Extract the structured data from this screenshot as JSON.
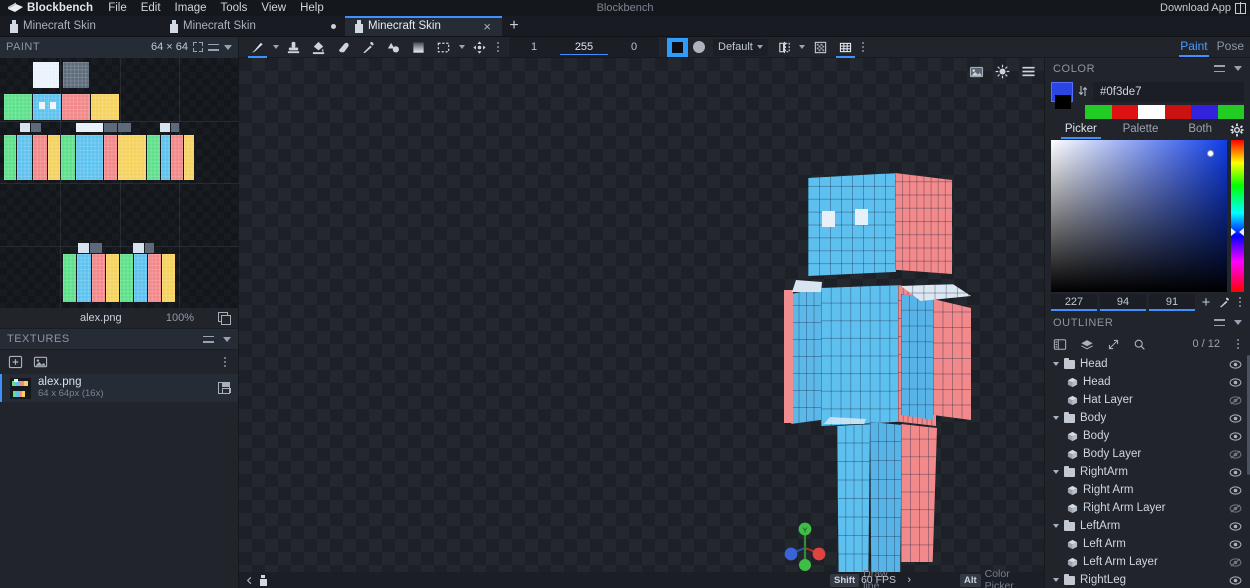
{
  "app": {
    "name": "Blockbench",
    "logo_icon": "blockbench-logo-icon",
    "window_title": "Blockbench",
    "download_app_label": "Download App",
    "restore_icon": "window-restore-icon"
  },
  "menubar": {
    "items": [
      "File",
      "Edit",
      "Image",
      "Tools",
      "View",
      "Help"
    ]
  },
  "tabs": {
    "items": [
      {
        "label": "Minecraft Skin",
        "active": false,
        "modified": false,
        "icon": "skin-person-icon"
      },
      {
        "label": "Minecraft Skin",
        "active": false,
        "modified": true,
        "icon": "skin-person-icon"
      },
      {
        "label": "Minecraft Skin",
        "active": true,
        "modified": false,
        "icon": "skin-person-icon"
      }
    ],
    "add_tab_label": "+",
    "close_label": "×"
  },
  "toolbar": {
    "panel_title": "PAINT",
    "texture_size": "64 × 64",
    "fullscreen_icon": "fullscreen-icon",
    "equals_icon": "drag-handle-icon",
    "chevron_icon": "chevron-down-icon",
    "tools": [
      {
        "name": "brush-tool",
        "label": "Brush",
        "active": true,
        "has_caret": true
      },
      {
        "name": "copy-paste-tool",
        "label": "Copy Paste Tool",
        "active": false
      },
      {
        "name": "fill-tool",
        "label": "Paint Bucket",
        "active": false
      },
      {
        "name": "eraser-tool",
        "label": "Eraser",
        "active": false
      },
      {
        "name": "color-picker-tool",
        "label": "Color Picker",
        "active": false
      },
      {
        "name": "draw-shape-tool",
        "label": "Draw Shape",
        "active": false
      },
      {
        "name": "gradient-tool",
        "label": "Gradient",
        "active": false
      },
      {
        "name": "selection-tool",
        "label": "Selection Tool",
        "active": false,
        "has_caret": true
      },
      {
        "name": "move-layer-tool",
        "label": "Move Layer",
        "active": false
      }
    ],
    "overflow_icon": "vertical-dots-icon",
    "numbers": [
      {
        "name": "brush-size-field",
        "value": "1",
        "active": false
      },
      {
        "name": "brush-opacity-field",
        "value": "255",
        "active": true
      },
      {
        "name": "brush-softness-field",
        "value": "0",
        "active": false
      }
    ],
    "shape_square_label": "square-brush-shape",
    "shape_circle_label": "circle-brush-shape",
    "blend_mode": "Default",
    "mirror_icon": "mirror-painting-icon",
    "pixel_grid_icon": "pixel-grid-icon",
    "grid_icon": "paint-grid-icon",
    "mode_tabs": [
      {
        "label": "Paint",
        "active": true
      },
      {
        "label": "Pose",
        "active": false
      }
    ]
  },
  "texture_panel": {
    "file_name": "alex.png",
    "zoom": "100%",
    "copy_icon": "duplicate-icon",
    "section_title": "TEXTURES",
    "tool_icons": [
      "create-texture-icon",
      "import-texture-icon"
    ],
    "overflow_icon": "vertical-dots-icon",
    "items": [
      {
        "name": "alex.png",
        "resolution": "64 x 64px (16x)",
        "selected": true,
        "save_icon": "save-icon"
      }
    ]
  },
  "viewport": {
    "icons": [
      "screenshot-icon",
      "lighting-icon",
      "viewport-menu-icon"
    ],
    "fps": "60 FPS",
    "fps_arrow": "›",
    "axis_gizmo": {
      "y_label": "Y",
      "x_color": "#e0453f",
      "y_color": "#46c74b",
      "z_color": "#3f6fe0"
    }
  },
  "statusbar": {
    "shortcuts": [
      {
        "key": "Shift",
        "action": "Draw line"
      },
      {
        "key": "Alt",
        "action": "Color Picker"
      }
    ],
    "left_icons": [
      "back-arrow-icon",
      "skin-person-icon"
    ]
  },
  "color_panel": {
    "title": "COLOR",
    "minimize_icon": "drag-handle-icon",
    "collapse_icon": "chevron-down-icon",
    "hex": "#0f3de7",
    "swap_icon": "swap-colors-icon",
    "main_color": "#0f3de7",
    "secondary_color": "#000000",
    "palette": [
      "#22cc22",
      "#dd1111",
      "#ffffff",
      "#cc1111",
      "#3322dd",
      "#22cc22"
    ],
    "tabs": [
      {
        "label": "Picker",
        "active": true
      },
      {
        "label": "Palette",
        "active": false
      },
      {
        "label": "Both",
        "active": false
      }
    ],
    "settings_icon": "gear-icon",
    "hsv": [
      {
        "name": "hue-field",
        "value": "227"
      },
      {
        "name": "saturation-field",
        "value": "94"
      },
      {
        "name": "value-field",
        "value": "91"
      }
    ],
    "add_color_label": "+",
    "eyedropper_icon": "eyedropper-icon",
    "overflow_icon": "vertical-dots-icon"
  },
  "outliner": {
    "title": "OUTLINER",
    "minimize_icon": "drag-handle-icon",
    "collapse_icon": "chevron-down-icon",
    "tool_icons": [
      "add-group-icon",
      "toggle-visibility-icon",
      "expand-all-icon",
      "search-icon"
    ],
    "count": "0 / 12",
    "overflow_icon": "vertical-dots-icon",
    "rows": [
      {
        "label": "Head",
        "type": "group",
        "visible": true
      },
      {
        "label": "Head",
        "type": "cube",
        "visible": true
      },
      {
        "label": "Hat Layer",
        "type": "cube",
        "visible": false
      },
      {
        "label": "Body",
        "type": "group",
        "visible": true
      },
      {
        "label": "Body",
        "type": "cube",
        "visible": true
      },
      {
        "label": "Body Layer",
        "type": "cube",
        "visible": false
      },
      {
        "label": "RightArm",
        "type": "group",
        "visible": true
      },
      {
        "label": "Right Arm",
        "type": "cube",
        "visible": true
      },
      {
        "label": "Right Arm Layer",
        "type": "cube",
        "visible": false
      },
      {
        "label": "LeftArm",
        "type": "group",
        "visible": true
      },
      {
        "label": "Left Arm",
        "type": "cube",
        "visible": true
      },
      {
        "label": "Left Arm Layer",
        "type": "cube",
        "visible": false
      },
      {
        "label": "RightLeg",
        "type": "group",
        "visible": true
      }
    ]
  }
}
